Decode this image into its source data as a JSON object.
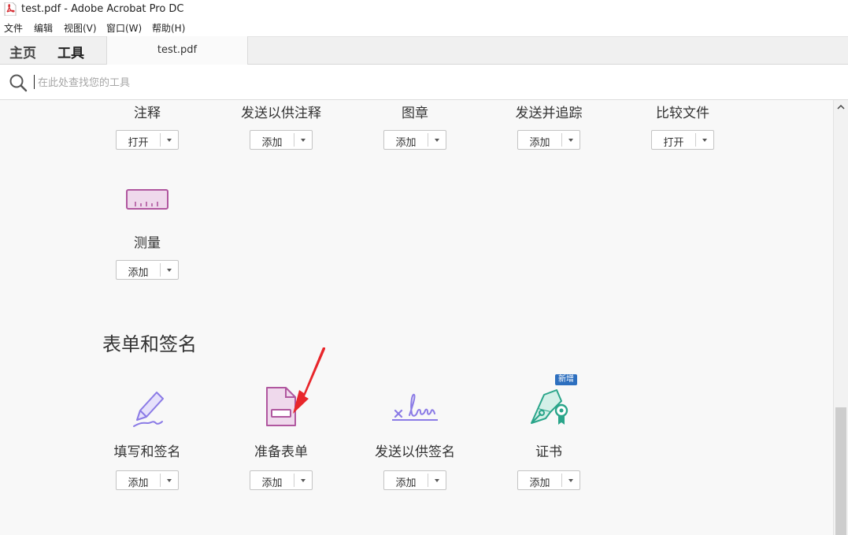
{
  "window": {
    "title": "test.pdf - Adobe Acrobat Pro DC"
  },
  "menu": [
    "文件",
    "编辑",
    "视图(V)",
    "窗口(W)",
    "帮助(H)"
  ],
  "nav_tabs": {
    "home": "主页",
    "tools": "工具",
    "document": "test.pdf"
  },
  "search": {
    "placeholder": "在此处查找您的工具"
  },
  "tools_top": [
    {
      "name": "注释",
      "action": "打开"
    },
    {
      "name": "发送以供注释",
      "action": "添加"
    },
    {
      "name": "图章",
      "action": "添加"
    },
    {
      "name": "发送并追踪",
      "action": "添加"
    },
    {
      "name": "比较文件",
      "action": "打开"
    }
  ],
  "tool_measure": {
    "name": "测量",
    "action": "添加"
  },
  "section_forms": {
    "title": "表单和签名",
    "tools": [
      {
        "name": "填写和签名",
        "action": "添加"
      },
      {
        "name": "准备表单",
        "action": "添加"
      },
      {
        "name": "发送以供签名",
        "action": "添加"
      },
      {
        "name": "证书",
        "action": "添加",
        "badge": "新增"
      }
    ]
  },
  "colors": {
    "accent_purple": "#b0579f",
    "fill_sign_purple": "#8b7be6",
    "certificate_green": "#2aa58a",
    "annotation_red": "#e8262b",
    "badge_blue": "#2d6fbf"
  },
  "icons": [
    "pdf-file-icon",
    "search-icon",
    "ruler-icon",
    "pen-sign-icon",
    "form-doc-icon",
    "signature-icon",
    "certificate-pen-icon",
    "chevron-down-icon",
    "scroll-up-icon"
  ]
}
